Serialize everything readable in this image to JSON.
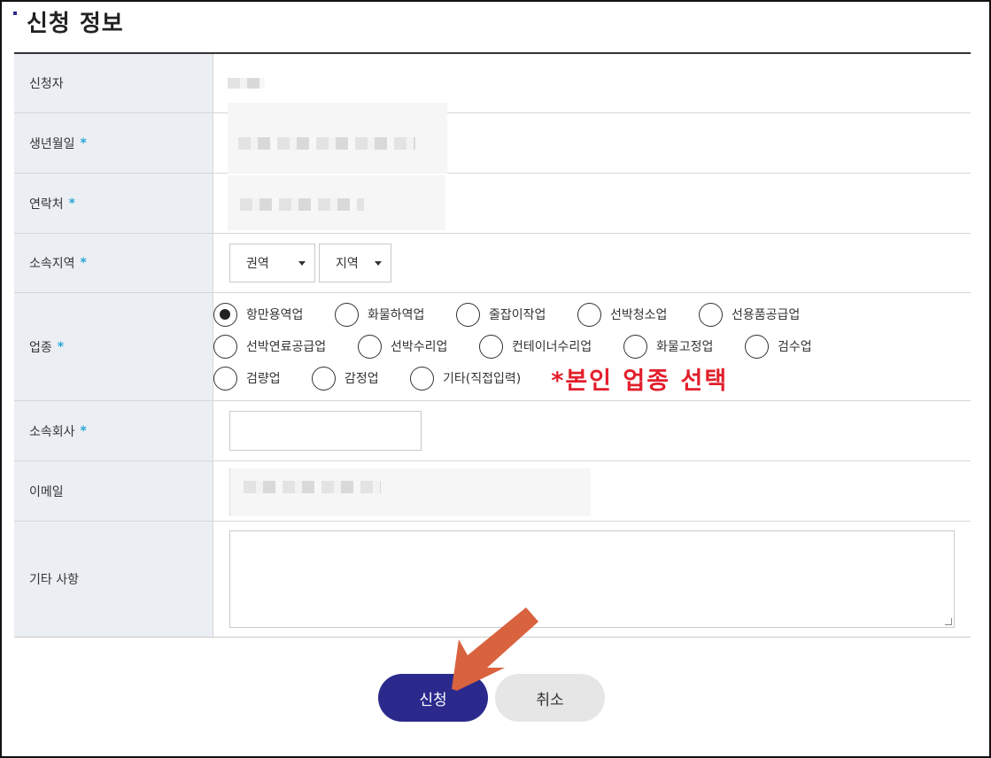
{
  "section_title": "신청 정보",
  "fields": {
    "applicant": {
      "label": "신청자",
      "required": false
    },
    "birthdate": {
      "label": "생년월일",
      "required": true
    },
    "contact": {
      "label": "연락처",
      "required": true
    },
    "region": {
      "label": "소속지역",
      "required": true,
      "select_area": "권역",
      "select_region": "지역"
    },
    "industry": {
      "label": "업종",
      "required": true
    },
    "company": {
      "label": "소속회사",
      "required": true,
      "value": ""
    },
    "email": {
      "label": "이메일",
      "required": false
    },
    "notes": {
      "label": "기타 사항",
      "required": false,
      "value": ""
    }
  },
  "required_mark": "*",
  "industry_options": [
    [
      {
        "label": "항만용역업",
        "checked": true
      },
      {
        "label": "화물하역업",
        "checked": false
      },
      {
        "label": "줄잡이작업",
        "checked": false
      },
      {
        "label": "선박청소업",
        "checked": false
      },
      {
        "label": "선용품공급업",
        "checked": false
      }
    ],
    [
      {
        "label": "선박연료공급업",
        "checked": false
      },
      {
        "label": "선박수리업",
        "checked": false
      },
      {
        "label": "컨테이너수리업",
        "checked": false
      },
      {
        "label": "화물고정업",
        "checked": false
      },
      {
        "label": "검수업",
        "checked": false
      }
    ],
    [
      {
        "label": "검량업",
        "checked": false
      },
      {
        "label": "감정업",
        "checked": false
      },
      {
        "label": "기타(직접입력)",
        "checked": false
      }
    ]
  ],
  "annotation": "*본인 업종 선택",
  "buttons": {
    "apply": "신청",
    "cancel": "취소"
  },
  "colors": {
    "primary": "#2b2a8c",
    "required_star": "#29a7d6",
    "annotation": "#e21f2c",
    "arrow": "#d9623f"
  }
}
